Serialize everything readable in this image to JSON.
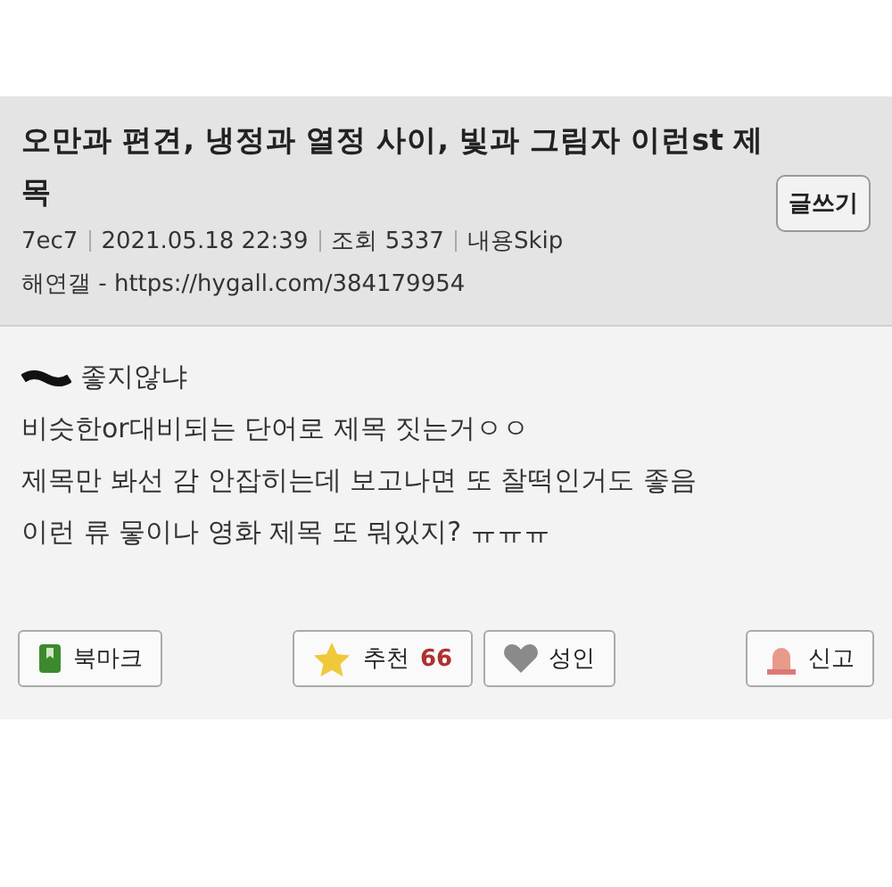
{
  "post": {
    "title": "오만과 편견, 냉정과 열정 사이, 빛과 그림자 이런st 제목",
    "write_button": "글쓰기",
    "meta": [
      "7ec7",
      "2021.05.18 22:39",
      "조회 5337",
      "내용Skip"
    ],
    "source": "해연갤 - https://hygall.com/384179954"
  },
  "body": [
    {
      "redacted": true,
      "text": "좋지않냐"
    },
    {
      "text": "비슷한or대비되는 단어로 제목 짓는거ㅇㅇ"
    },
    {
      "text": "제목만 봐선 감 안잡히는데 보고나면 또 찰떡인거도 좋음"
    },
    {
      "text": "이런 류 뭏이나 영화 제목 또 뭐있지? ㅠㅠㅠ"
    }
  ],
  "actions": [
    {
      "kind": "bookmark",
      "label": "북마크"
    },
    {
      "kind": "recommend",
      "label": "추천",
      "count": "66"
    },
    {
      "kind": "adult",
      "label": "성인"
    },
    {
      "kind": "report",
      "label": "신고"
    }
  ]
}
